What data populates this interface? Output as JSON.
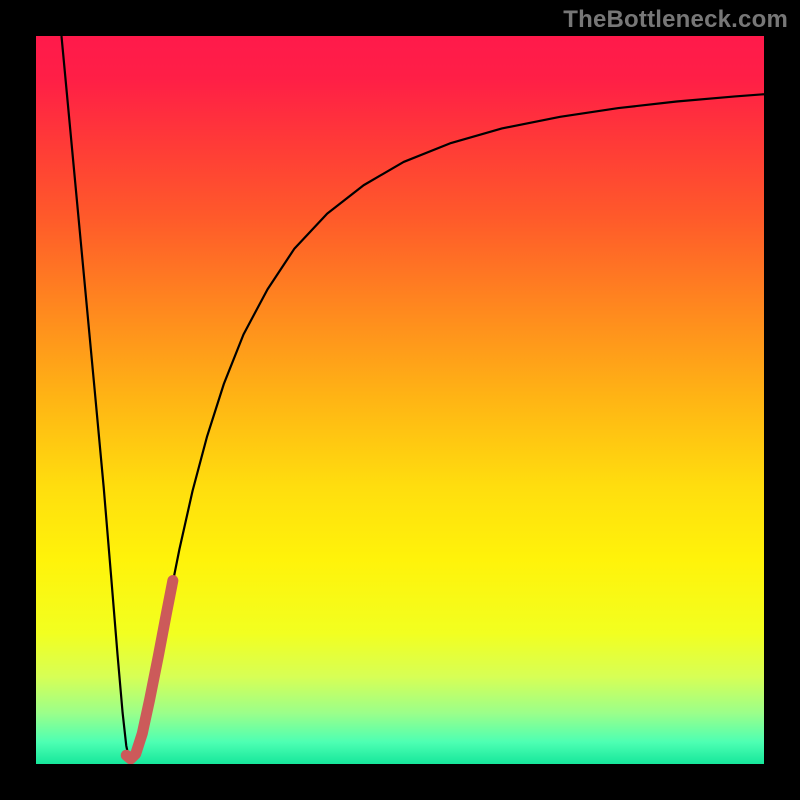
{
  "watermark": "TheBottleneck.com",
  "chart_data": {
    "type": "line",
    "title": "",
    "xlabel": "",
    "ylabel": "",
    "xlim": [
      0,
      100
    ],
    "ylim": [
      0,
      100
    ],
    "background_gradient": {
      "stops": [
        {
          "offset": 0.0,
          "color": "#ff1a4b"
        },
        {
          "offset": 0.06,
          "color": "#ff1f46"
        },
        {
          "offset": 0.15,
          "color": "#ff3b37"
        },
        {
          "offset": 0.25,
          "color": "#ff5a2a"
        },
        {
          "offset": 0.38,
          "color": "#ff8a1e"
        },
        {
          "offset": 0.5,
          "color": "#ffb514"
        },
        {
          "offset": 0.62,
          "color": "#ffde0e"
        },
        {
          "offset": 0.72,
          "color": "#fff30a"
        },
        {
          "offset": 0.82,
          "color": "#f2ff20"
        },
        {
          "offset": 0.88,
          "color": "#d7ff55"
        },
        {
          "offset": 0.93,
          "color": "#9bff8a"
        },
        {
          "offset": 0.97,
          "color": "#4dffb3"
        },
        {
          "offset": 1.0,
          "color": "#16e79b"
        }
      ]
    },
    "series": [
      {
        "name": "primary-curve",
        "color": "#000000",
        "width": 2.2,
        "points": [
          {
            "x": 3.5,
            "y": 100.0
          },
          {
            "x": 5.0,
            "y": 84.0
          },
          {
            "x": 6.5,
            "y": 68.0
          },
          {
            "x": 8.0,
            "y": 52.0
          },
          {
            "x": 9.3,
            "y": 38.0
          },
          {
            "x": 10.3,
            "y": 26.0
          },
          {
            "x": 11.2,
            "y": 15.0
          },
          {
            "x": 11.9,
            "y": 7.0
          },
          {
            "x": 12.4,
            "y": 2.5
          },
          {
            "x": 12.8,
            "y": 0.6
          },
          {
            "x": 13.2,
            "y": 0.5
          },
          {
            "x": 13.8,
            "y": 1.4
          },
          {
            "x": 14.6,
            "y": 4.0
          },
          {
            "x": 15.6,
            "y": 8.8
          },
          {
            "x": 16.8,
            "y": 14.8
          },
          {
            "x": 18.2,
            "y": 22.0
          },
          {
            "x": 19.7,
            "y": 29.5
          },
          {
            "x": 21.5,
            "y": 37.5
          },
          {
            "x": 23.5,
            "y": 45.0
          },
          {
            "x": 25.8,
            "y": 52.2
          },
          {
            "x": 28.5,
            "y": 59.0
          },
          {
            "x": 31.8,
            "y": 65.2
          },
          {
            "x": 35.5,
            "y": 70.8
          },
          {
            "x": 40.0,
            "y": 75.6
          },
          {
            "x": 45.0,
            "y": 79.5
          },
          {
            "x": 50.5,
            "y": 82.7
          },
          {
            "x": 57.0,
            "y": 85.3
          },
          {
            "x": 64.0,
            "y": 87.3
          },
          {
            "x": 72.0,
            "y": 88.9
          },
          {
            "x": 80.0,
            "y": 90.1
          },
          {
            "x": 88.0,
            "y": 91.0
          },
          {
            "x": 96.0,
            "y": 91.7
          },
          {
            "x": 100.0,
            "y": 92.0
          }
        ]
      },
      {
        "name": "highlight-segment",
        "color": "#cc5a5a",
        "width": 11,
        "linecap": "round",
        "points": [
          {
            "x": 12.4,
            "y": 1.2
          },
          {
            "x": 13.0,
            "y": 0.7
          },
          {
            "x": 13.7,
            "y": 1.4
          },
          {
            "x": 14.6,
            "y": 4.2
          },
          {
            "x": 15.6,
            "y": 8.8
          },
          {
            "x": 16.8,
            "y": 14.8
          },
          {
            "x": 17.9,
            "y": 20.6
          },
          {
            "x": 18.8,
            "y": 25.2
          }
        ]
      }
    ]
  }
}
